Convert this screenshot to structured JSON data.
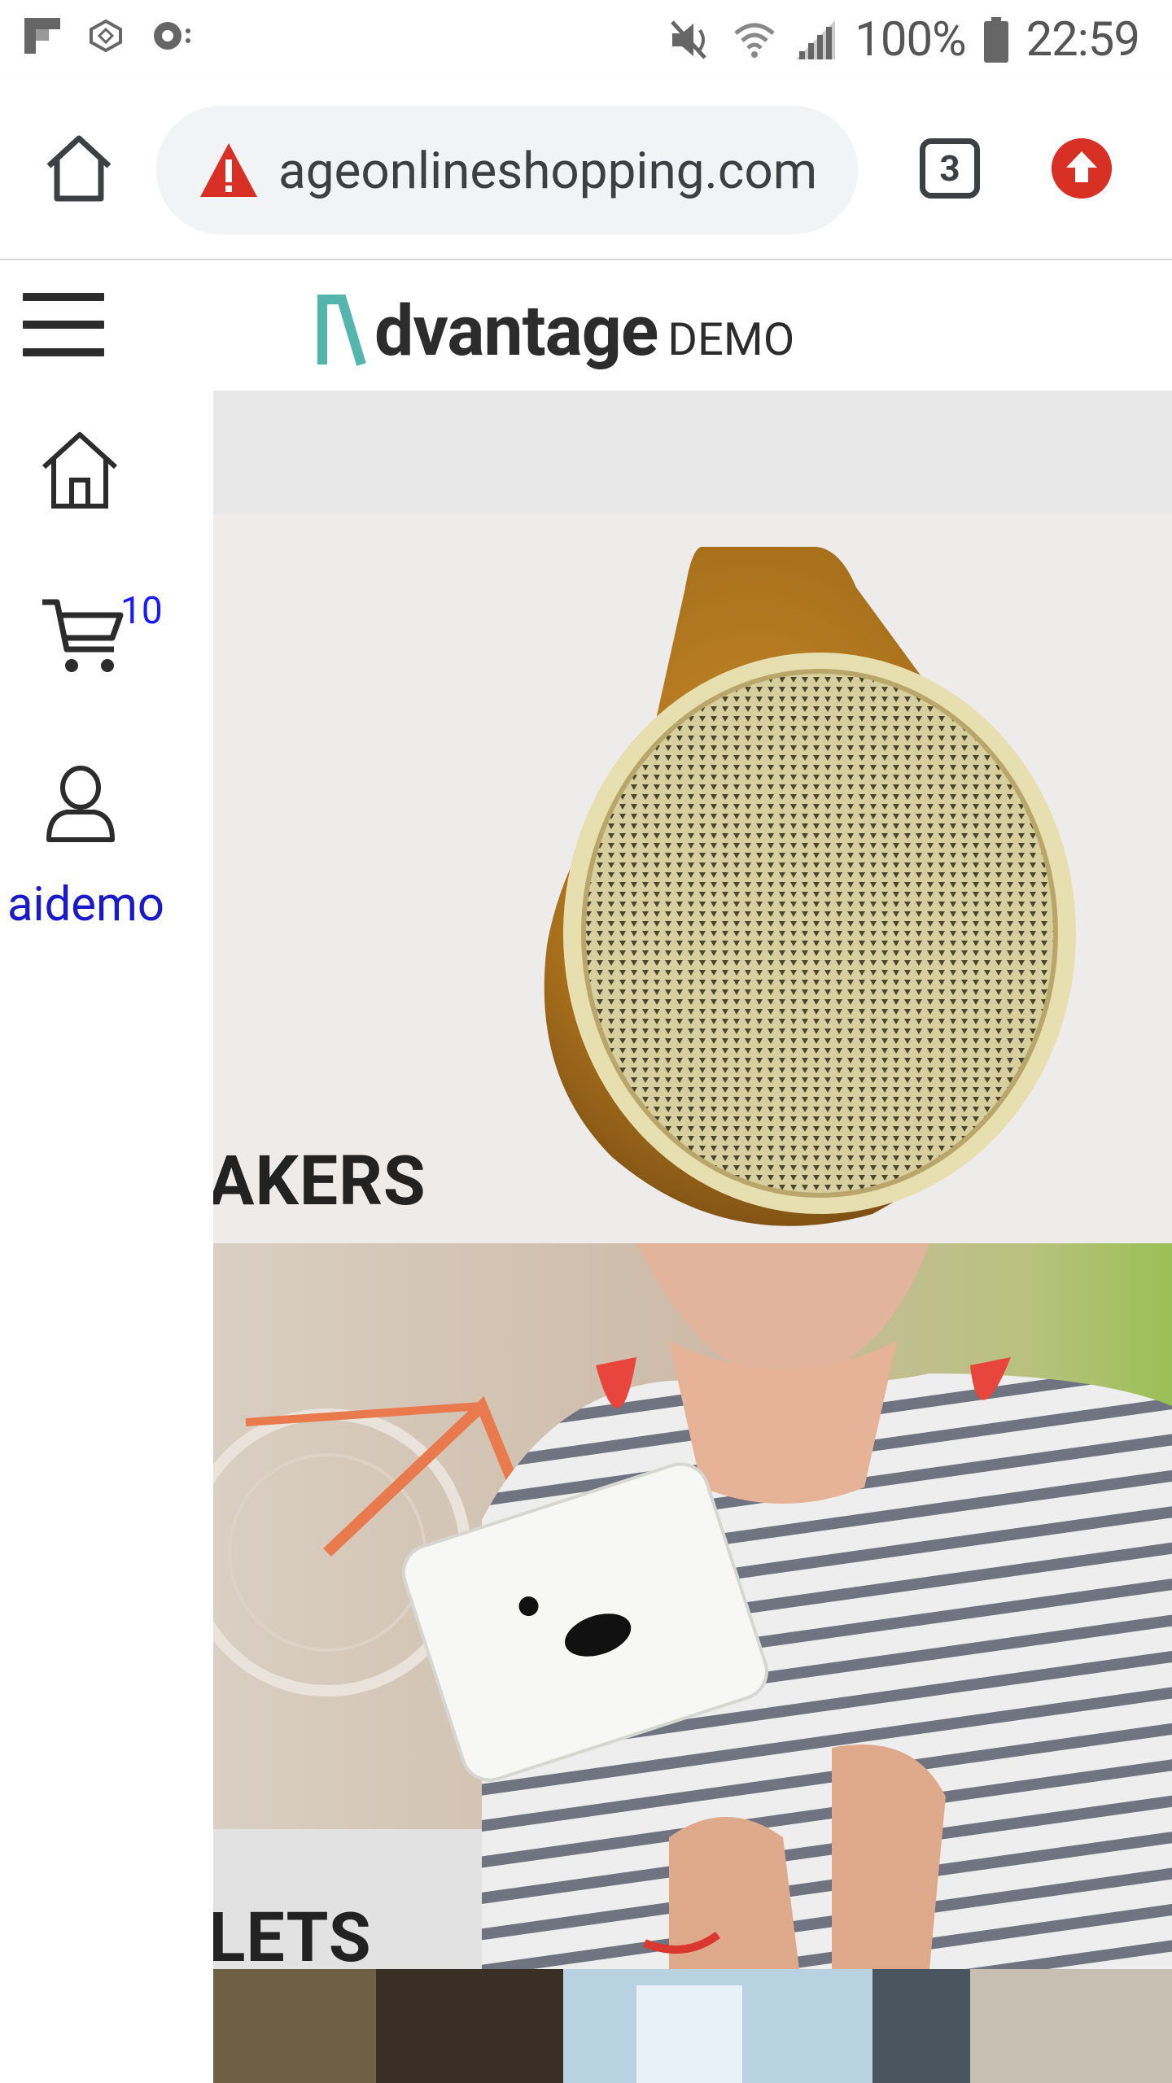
{
  "status_bar": {
    "battery": "100%",
    "time": "22:59"
  },
  "browser": {
    "url": "ageonlineshopping.com",
    "tab_count": "3"
  },
  "header": {
    "logo_word": "dvantage",
    "logo_suffix": "DEMO"
  },
  "side_menu": {
    "cart_count": "10",
    "username": "aidemo"
  },
  "categories": [
    {
      "label": "AKERS"
    },
    {
      "label": "LETS"
    }
  ],
  "colors": {
    "brand_teal": "#54b5ad",
    "link_blue": "#1a1acc",
    "warning_red": "#d93025"
  }
}
